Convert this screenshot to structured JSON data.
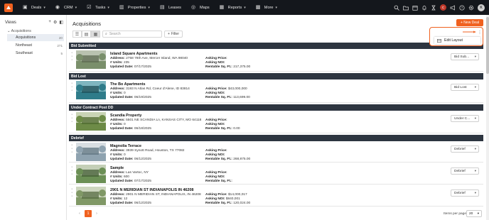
{
  "nav": {
    "items": [
      {
        "label": "Deals",
        "icon": "deals-icon",
        "has_menu": true
      },
      {
        "label": "CRM",
        "icon": "crm-icon",
        "has_menu": true
      },
      {
        "label": "Tasks",
        "icon": "tasks-icon",
        "has_menu": true
      },
      {
        "label": "Properties",
        "icon": "properties-icon",
        "has_menu": true
      },
      {
        "label": "Leases",
        "icon": "leases-icon",
        "has_menu": false
      },
      {
        "label": "Maps",
        "icon": "maps-icon",
        "has_menu": false
      },
      {
        "label": "Reports",
        "icon": "reports-icon",
        "has_menu": true
      },
      {
        "label": "More",
        "icon": "more-icon",
        "has_menu": true
      }
    ],
    "user_initial_small": "C",
    "user_initial": "K",
    "accent": "#f0611f"
  },
  "sidebar": {
    "title": "Views",
    "group": "Acquisitions",
    "items": [
      {
        "label": "Acquisitions",
        "count": "20"
      },
      {
        "label": "Northeast",
        "count": "271"
      },
      {
        "label": "Southeast",
        "count": "5"
      }
    ]
  },
  "main": {
    "title": "Acquisitions",
    "new_button": "+ New Deal",
    "search_placeholder": "Search",
    "filter_label": "Filter"
  },
  "labels": {
    "address": "Address:",
    "units": "# Units:",
    "updated": "Updated Date:",
    "asking": "Asking Price:",
    "noi": "Asking NOI:",
    "rentable": "Rentable Sq. Ft.:"
  },
  "sections": [
    {
      "title": "Bid Submitted"
    },
    {
      "title": "Bid Lost"
    },
    {
      "title": "Under Contract Post DD"
    },
    {
      "title": "Debrief"
    }
  ],
  "deals": [
    {
      "name": "Island Square Apartments",
      "address": "2758 78th Ave, Mercer Island, WA 98040",
      "units": "235",
      "updated": "07/17/2025",
      "asking": "",
      "noi": "",
      "rentable": "217,375.00",
      "stage": "Bid Sub..."
    },
    {
      "name": "The Bo Apartments",
      "address": "3193 N Atlas Rd, Coeur d'Alene, ID 83814",
      "units": "0",
      "updated": "06/19/2025",
      "asking": "$43,000,000",
      "noi": "",
      "rentable": "113,699.00",
      "stage": "Bid Lost"
    },
    {
      "name": "Scandia Property",
      "address": "5501 NE SCANDIA Ln, KANSAS CITY, MO 64118",
      "units": "0",
      "updated": "06/18/2025",
      "asking": "",
      "noi": "",
      "rentable": "0.00",
      "stage": "Under C..."
    },
    {
      "name": "Magnolia Terrace",
      "address": "3939 Synott Road, Houston, TX 77082",
      "units": "0",
      "updated": "06/12/2025",
      "asking": "",
      "noi": "",
      "rentable": "268,875.00",
      "stage": "Debrief"
    },
    {
      "name": "Sample",
      "address": "Las Vartoc, NY",
      "units": "600",
      "updated": "07/17/2025",
      "asking": "",
      "noi": "",
      "rentable": "",
      "stage": "Debrief"
    },
    {
      "name": "2901 N MERIDIAN ST INDIANAPOLIS IN 46208",
      "address": "2901 N MERIDIAN ST, INDIANAPOLIS, IN 46208",
      "units": "12",
      "updated": "06/12/2025",
      "asking": "$14,000,017",
      "noi": "$840,001",
      "rentable": "120,024.00",
      "stage": "Debrief"
    }
  ],
  "pagination": {
    "current": "1",
    "prev": "‹",
    "next": "›",
    "items_label": "Items per page:",
    "items_value": "20"
  },
  "popup": {
    "menu_label": "Edit Layout"
  }
}
